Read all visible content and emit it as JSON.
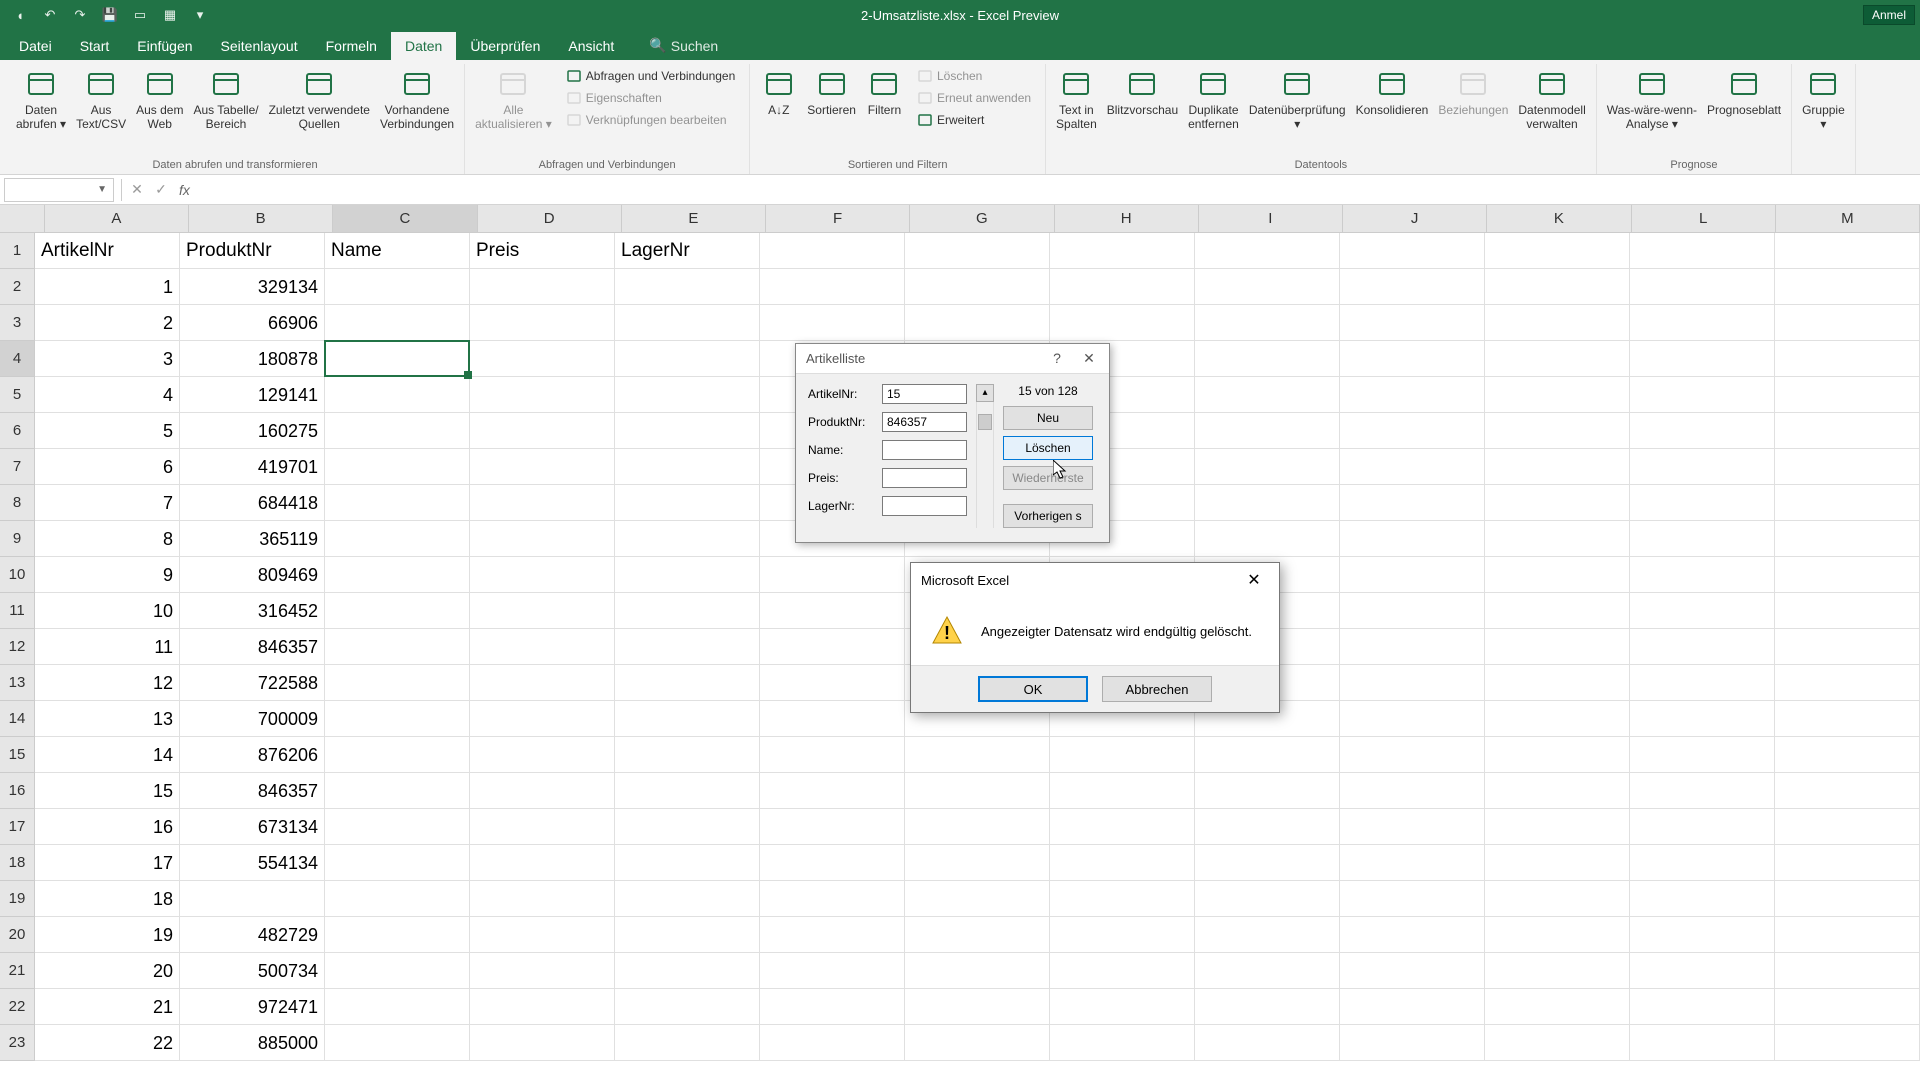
{
  "titlebar": {
    "title": "2-Umsatzliste.xlsx - Excel Preview",
    "right_button": "Anmel"
  },
  "tabs": {
    "file": "Datei",
    "items": [
      "Start",
      "Einfügen",
      "Seitenlayout",
      "Formeln",
      "Daten",
      "Überprüfen",
      "Ansicht"
    ],
    "active_index": 4,
    "search": "Suchen"
  },
  "ribbon": {
    "groups": [
      {
        "label": "Daten abrufen und transformieren",
        "big": [
          {
            "line1": "Daten",
            "line2": "abrufen ▾"
          },
          {
            "line1": "Aus",
            "line2": "Text/CSV"
          },
          {
            "line1": "Aus dem",
            "line2": "Web"
          },
          {
            "line1": "Aus Tabelle/",
            "line2": "Bereich"
          },
          {
            "line1": "Zuletzt verwendete",
            "line2": "Quellen"
          },
          {
            "line1": "Vorhandene",
            "line2": "Verbindungen"
          }
        ]
      },
      {
        "label": "Abfragen und Verbindungen",
        "big": [
          {
            "line1": "Alle",
            "line2": "aktualisieren ▾",
            "disabled": true
          }
        ],
        "small": [
          {
            "label": "Abfragen und Verbindungen"
          },
          {
            "label": "Eigenschaften",
            "disabled": true
          },
          {
            "label": "Verknüpfungen bearbeiten",
            "disabled": true
          }
        ]
      },
      {
        "label": "Sortieren und Filtern",
        "big": [
          {
            "line1": "A↓Z",
            "line2": ""
          },
          {
            "line1": "Sortieren",
            "line2": ""
          },
          {
            "line1": "Filtern",
            "line2": ""
          }
        ],
        "small": [
          {
            "label": "Löschen",
            "disabled": true
          },
          {
            "label": "Erneut anwenden",
            "disabled": true
          },
          {
            "label": "Erweitert"
          }
        ]
      },
      {
        "label": "Datentools",
        "big": [
          {
            "line1": "Text in",
            "line2": "Spalten"
          },
          {
            "line1": "Blitzvorschau",
            "line2": ""
          },
          {
            "line1": "Duplikate",
            "line2": "entfernen"
          },
          {
            "line1": "Datenüberprüfung",
            "line2": "▾"
          },
          {
            "line1": "Konsolidieren",
            "line2": ""
          },
          {
            "line1": "Beziehungen",
            "line2": "",
            "disabled": true
          },
          {
            "line1": "Datenmodell",
            "line2": "verwalten"
          }
        ]
      },
      {
        "label": "Prognose",
        "big": [
          {
            "line1": "Was-wäre-wenn-",
            "line2": "Analyse ▾"
          },
          {
            "line1": "Prognoseblatt",
            "line2": ""
          }
        ]
      },
      {
        "label": "",
        "big": [
          {
            "line1": "Gruppie",
            "line2": "▾"
          }
        ]
      }
    ]
  },
  "formula_bar": {
    "name_box": "",
    "value": ""
  },
  "sheet": {
    "columns": [
      "A",
      "B",
      "C",
      "D",
      "E",
      "F",
      "G",
      "H",
      "I",
      "J",
      "K",
      "L",
      "M"
    ],
    "selected_col": 2,
    "selected_row": 3,
    "headers": [
      "ArtikelNr",
      "ProduktNr",
      "Name",
      "Preis",
      "LagerNr"
    ],
    "rows": [
      {
        "n": 1,
        "a": "1",
        "b": "329134"
      },
      {
        "n": 2,
        "a": "2",
        "b": "66906"
      },
      {
        "n": 3,
        "a": "3",
        "b": "180878"
      },
      {
        "n": 4,
        "a": "4",
        "b": "129141"
      },
      {
        "n": 5,
        "a": "5",
        "b": "160275"
      },
      {
        "n": 6,
        "a": "6",
        "b": "419701"
      },
      {
        "n": 7,
        "a": "7",
        "b": "684418"
      },
      {
        "n": 8,
        "a": "8",
        "b": "365119"
      },
      {
        "n": 9,
        "a": "9",
        "b": "809469"
      },
      {
        "n": 10,
        "a": "10",
        "b": "316452"
      },
      {
        "n": 11,
        "a": "11",
        "b": "846357"
      },
      {
        "n": 12,
        "a": "12",
        "b": "722588"
      },
      {
        "n": 13,
        "a": "13",
        "b": "700009"
      },
      {
        "n": 14,
        "a": "14",
        "b": "876206"
      },
      {
        "n": 15,
        "a": "15",
        "b": "846357"
      },
      {
        "n": 16,
        "a": "16",
        "b": "673134"
      },
      {
        "n": 17,
        "a": "17",
        "b": "554134"
      },
      {
        "n": 18,
        "a": "18",
        "b": ""
      },
      {
        "n": 19,
        "a": "19",
        "b": "482729"
      },
      {
        "n": 20,
        "a": "20",
        "b": "500734"
      },
      {
        "n": 21,
        "a": "21",
        "b": "972471"
      },
      {
        "n": 22,
        "a": "22",
        "b": "885000"
      }
    ]
  },
  "form_dialog": {
    "title": "Artikelliste",
    "counter": "15 von 128",
    "fields": [
      {
        "label": "ArtikelNr:",
        "value": "15"
      },
      {
        "label": "ProduktNr:",
        "value": "846357"
      },
      {
        "label": "Name:",
        "value": ""
      },
      {
        "label": "Preis:",
        "value": ""
      },
      {
        "label": "LagerNr:",
        "value": ""
      }
    ],
    "buttons": {
      "neu": "Neu",
      "loeschen": "Löschen",
      "wiederherstellen": "Wiederherste",
      "vorherigen": "Vorherigen s"
    }
  },
  "msgbox": {
    "title": "Microsoft Excel",
    "text": "Angezeigter Datensatz wird endgültig gelöscht.",
    "ok": "OK",
    "cancel": "Abbrechen"
  }
}
